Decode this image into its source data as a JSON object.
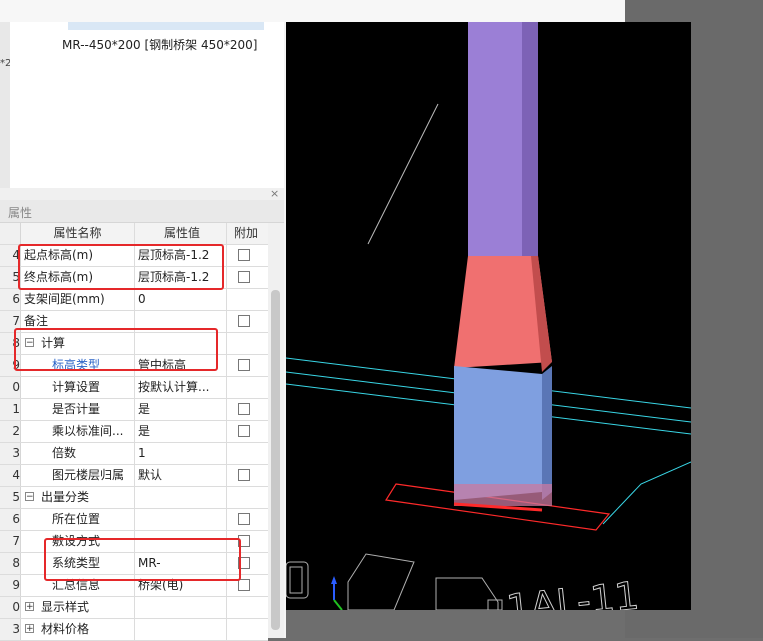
{
  "upper_pane": {
    "item_text": "MR--450*200 [钢制桥架 450*200]",
    "left_sliver_text": "*2"
  },
  "properties_panel": {
    "title": "属性",
    "close_glyph": "×",
    "columns": {
      "name": "属性名称",
      "value": "属性值",
      "extra": "附加"
    },
    "rows": [
      {
        "num": "4",
        "name": "起点标高(m)",
        "value": "层顶标高-1.2",
        "checkbox": true
      },
      {
        "num": "5",
        "name": "终点标高(m)",
        "value": "层顶标高-1.2",
        "checkbox": true
      },
      {
        "num": "6",
        "name": "支架间距(mm)",
        "value": "0",
        "checkbox": false
      },
      {
        "num": "7",
        "name": "备注",
        "value": "",
        "checkbox": true
      },
      {
        "num": "8",
        "name": "计算",
        "value": "",
        "checkbox": false,
        "group": true,
        "expander": "−"
      },
      {
        "num": "9",
        "name": "标高类型",
        "value": "管中标高",
        "checkbox": true,
        "indent": true,
        "link": true
      },
      {
        "num": "0",
        "name": "计算设置",
        "value": "按默认计算...",
        "checkbox": false,
        "indent": true
      },
      {
        "num": "1",
        "name": "是否计量",
        "value": "是",
        "checkbox": true,
        "indent": true
      },
      {
        "num": "2",
        "name": "乘以标准间...",
        "value": "是",
        "checkbox": true,
        "indent": true
      },
      {
        "num": "3",
        "name": "倍数",
        "value": "1",
        "checkbox": false,
        "indent": true
      },
      {
        "num": "4",
        "name": "图元楼层归属",
        "value": "默认",
        "checkbox": true,
        "indent": true
      },
      {
        "num": "5",
        "name": "出量分类",
        "value": "",
        "checkbox": false,
        "group": true,
        "expander": "−"
      },
      {
        "num": "6",
        "name": "所在位置",
        "value": "",
        "checkbox": true,
        "indent": true
      },
      {
        "num": "7",
        "name": "敷设方式",
        "value": "",
        "checkbox": true,
        "indent": true
      },
      {
        "num": "8",
        "name": "系统类型",
        "value": "MR-",
        "checkbox": true,
        "indent": true
      },
      {
        "num": "9",
        "name": "汇总信息",
        "value": "桥架(电)",
        "checkbox": true,
        "indent": true
      },
      {
        "num": "0",
        "name": "显示样式",
        "value": "",
        "checkbox": false,
        "group": true,
        "expander": "+"
      },
      {
        "num": "3",
        "name": "材料价格",
        "value": "",
        "checkbox": false,
        "group": true,
        "expander": "+"
      }
    ]
  },
  "viewport": {
    "label_text": "1AL-11",
    "colors": {
      "background": "#000000",
      "column_purple": "#9b7fd6",
      "transition_red": "#f07070",
      "lower_blue": "#7f9fe0",
      "outline_red": "#ff2a2a",
      "cyan_lines": "#39d6e6",
      "annotation": "#e5282a"
    }
  }
}
